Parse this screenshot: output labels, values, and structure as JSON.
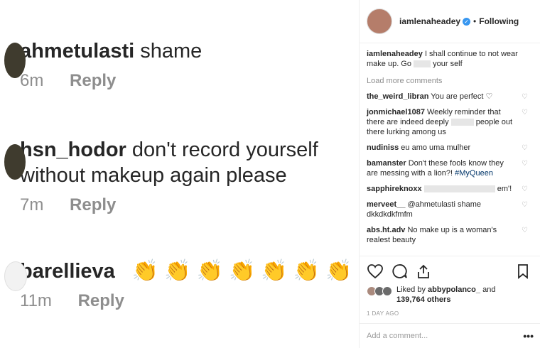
{
  "zoom_comments": [
    {
      "username": "ahmetulasti",
      "text": "shame",
      "time": "6m",
      "reply": "Reply"
    },
    {
      "username": "hsn_hodor",
      "text": "don't record yourself without makeup again please",
      "time": "7m",
      "reply": "Reply"
    },
    {
      "username": "barellieva",
      "text": "",
      "time": "11m",
      "reply": "Reply",
      "emoji": "👏",
      "emoji_count": 7
    }
  ],
  "post": {
    "username": "iamlenaheadey",
    "follow_status": "Following",
    "caption_user": "iamlenaheadey",
    "caption_text_1": "I shall continue to not wear make up. Go",
    "caption_text_2": "your self",
    "load_more": "Load more comments",
    "comments": [
      {
        "user": "the_weird_libran",
        "text": "You are perfect ♡"
      },
      {
        "user": "jonmichael1087",
        "text": "Weekly reminder that there are indeed deeply",
        "text2": "people out there lurking among us"
      },
      {
        "user": "nudiniss",
        "text": "eu amo uma mulher"
      },
      {
        "user": "bamanster",
        "text": "Don't these fools know they are messing with a lion?!",
        "hashtag": "#MyQueen"
      },
      {
        "user": "sapphireknoxx",
        "text": "em'!"
      },
      {
        "user": "merveet__",
        "text": "@ahmetulasti shame dkkdkdkfmfm"
      },
      {
        "user": "abs.ht.adv",
        "text": "No make up is a woman's realest beauty"
      }
    ],
    "liked_by_prefix": "Liked by",
    "liked_by_user": "abbypolanco_",
    "liked_by_and": "and",
    "liked_by_count": "139,764 others",
    "timestamp": "1 DAY AGO",
    "add_comment_placeholder": "Add a comment...",
    "more": "•••"
  }
}
